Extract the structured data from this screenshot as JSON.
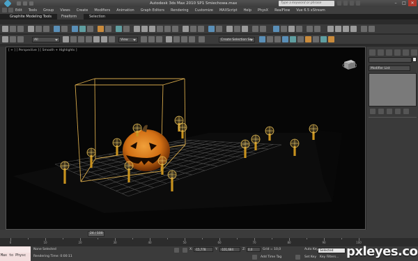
{
  "titlebar": {
    "title": "Autodesk 3ds Max  2010 SP1     Smiechowa.max",
    "search_placeholder": "Type a keyword or phrase",
    "window_controls": [
      "–",
      "□",
      "✕"
    ]
  },
  "menu": {
    "items": [
      "Edit",
      "Tools",
      "Group",
      "Views",
      "Create",
      "Modifiers",
      "Animation",
      "Graph Editors",
      "Rendering",
      "Customize",
      "MAXScript",
      "Help",
      "PhysX",
      "RealFlow",
      "Vue 6.5 xStream"
    ]
  },
  "ribbon": {
    "label": "Graphite Modeling Tools",
    "tabs": [
      "Freeform",
      "Selection"
    ],
    "active_tab": "Freeform"
  },
  "toolbar": {
    "selection_filter": "All",
    "reference_coord": "View",
    "named_selection": "Create Selection Se"
  },
  "viewport": {
    "label": "[ + ] [ Perspective ] [ Smooth + Highlights ]"
  },
  "command_panel": {
    "modifier_list": "Modifier List"
  },
  "time_slider": {
    "position": "24 / 100",
    "fraction": 0.24,
    "ticks": [
      "0",
      "10",
      "20",
      "30",
      "40",
      "50",
      "60",
      "70",
      "80",
      "90",
      "100"
    ]
  },
  "status": {
    "maxscript_text": "Max to Physc",
    "selection_status": "None Selected",
    "render_time": "Rendering Time: 0:00:11",
    "x_label": "X:",
    "x_value": "-15,778",
    "y_label": "Y:",
    "y_value": "-101,684",
    "z_label": "Z:",
    "z_value": "0,0",
    "grid": "Grid = 10,0",
    "add_time_tag": "Add Time Tag",
    "auto_key": "Auto Key",
    "set_key": "Set Key",
    "key_filters": "Key Filters...",
    "selected_option": "Selected"
  },
  "watermark": "pxleyes.com",
  "colors": {
    "accent": "#c98b3c",
    "selection_box": "#d4a74a",
    "pumpkin": "#e2861c",
    "grid": "#5a5a5a"
  }
}
